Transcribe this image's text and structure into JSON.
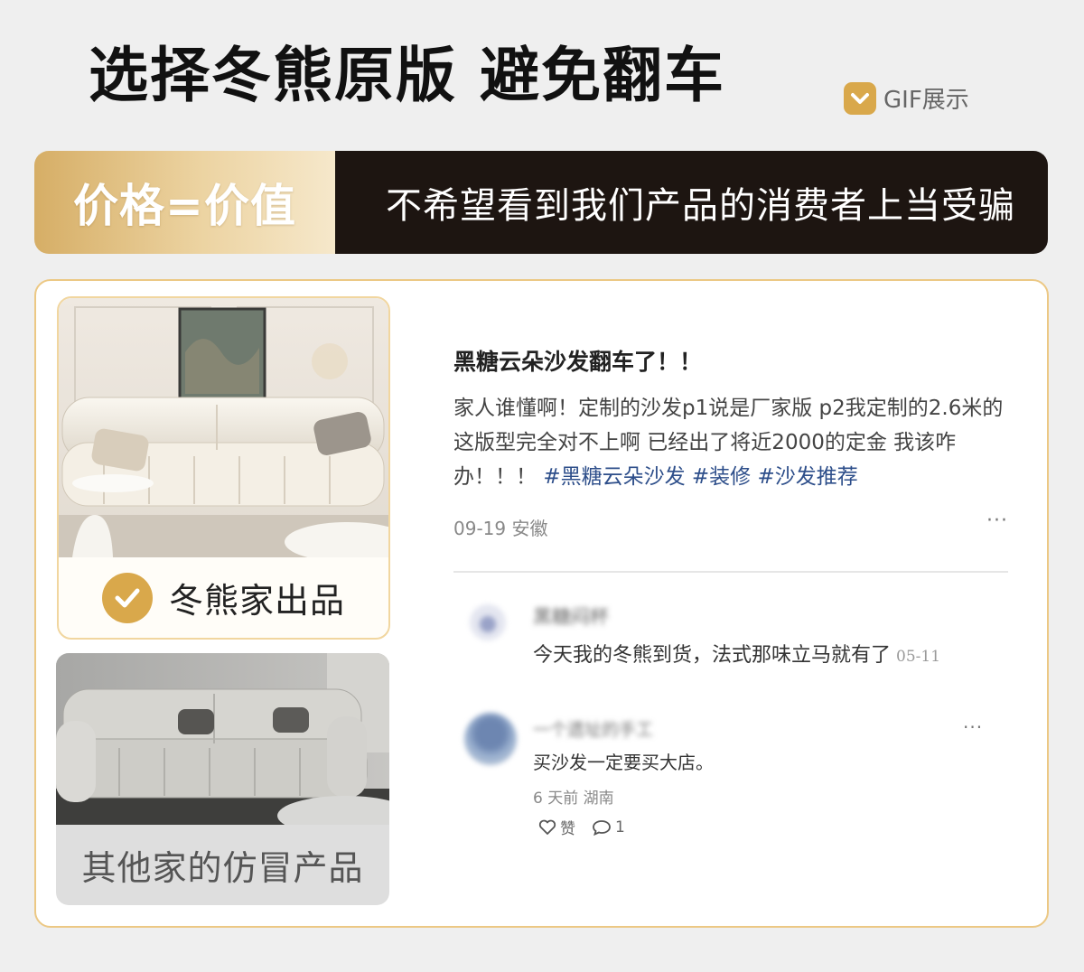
{
  "header": {
    "title": "选择冬熊原版 避免翻车",
    "gif_label": "GIF展示"
  },
  "banner": {
    "left_text": "价格=价值",
    "right_text": "不希望看到我们产品的消费者上当受骗"
  },
  "comparison": {
    "original_label": "冬熊家出品",
    "fake_label": "其他家的仿冒产品"
  },
  "post": {
    "title": "黑糖云朵沙发翻车了！！",
    "body": "家人谁懂啊！定制的沙发p1说是厂家版 p2我定制的2.6米的 这版型完全对不上啊 已经出了将近2000的定金 我该咋办！！！",
    "tags": [
      "#黑糖云朵沙发",
      "#装修",
      "#沙发推荐"
    ],
    "meta": "09-19 安徽",
    "more": "···"
  },
  "comments": [
    {
      "name": "黑糖闷杯",
      "text": "今天我的冬熊到货，法式那味立马就有了",
      "date": "05-11"
    },
    {
      "name": "一个遗址的手工",
      "text": "买沙发一定要买大店。",
      "meta": "6 天前 湖南",
      "like_label": "赞",
      "reply_count": "1",
      "more": "···"
    }
  ],
  "colors": {
    "accent_gold": "#d9a84b",
    "banner_dark": "#1d1511",
    "tag_blue": "#2d4e8a"
  }
}
